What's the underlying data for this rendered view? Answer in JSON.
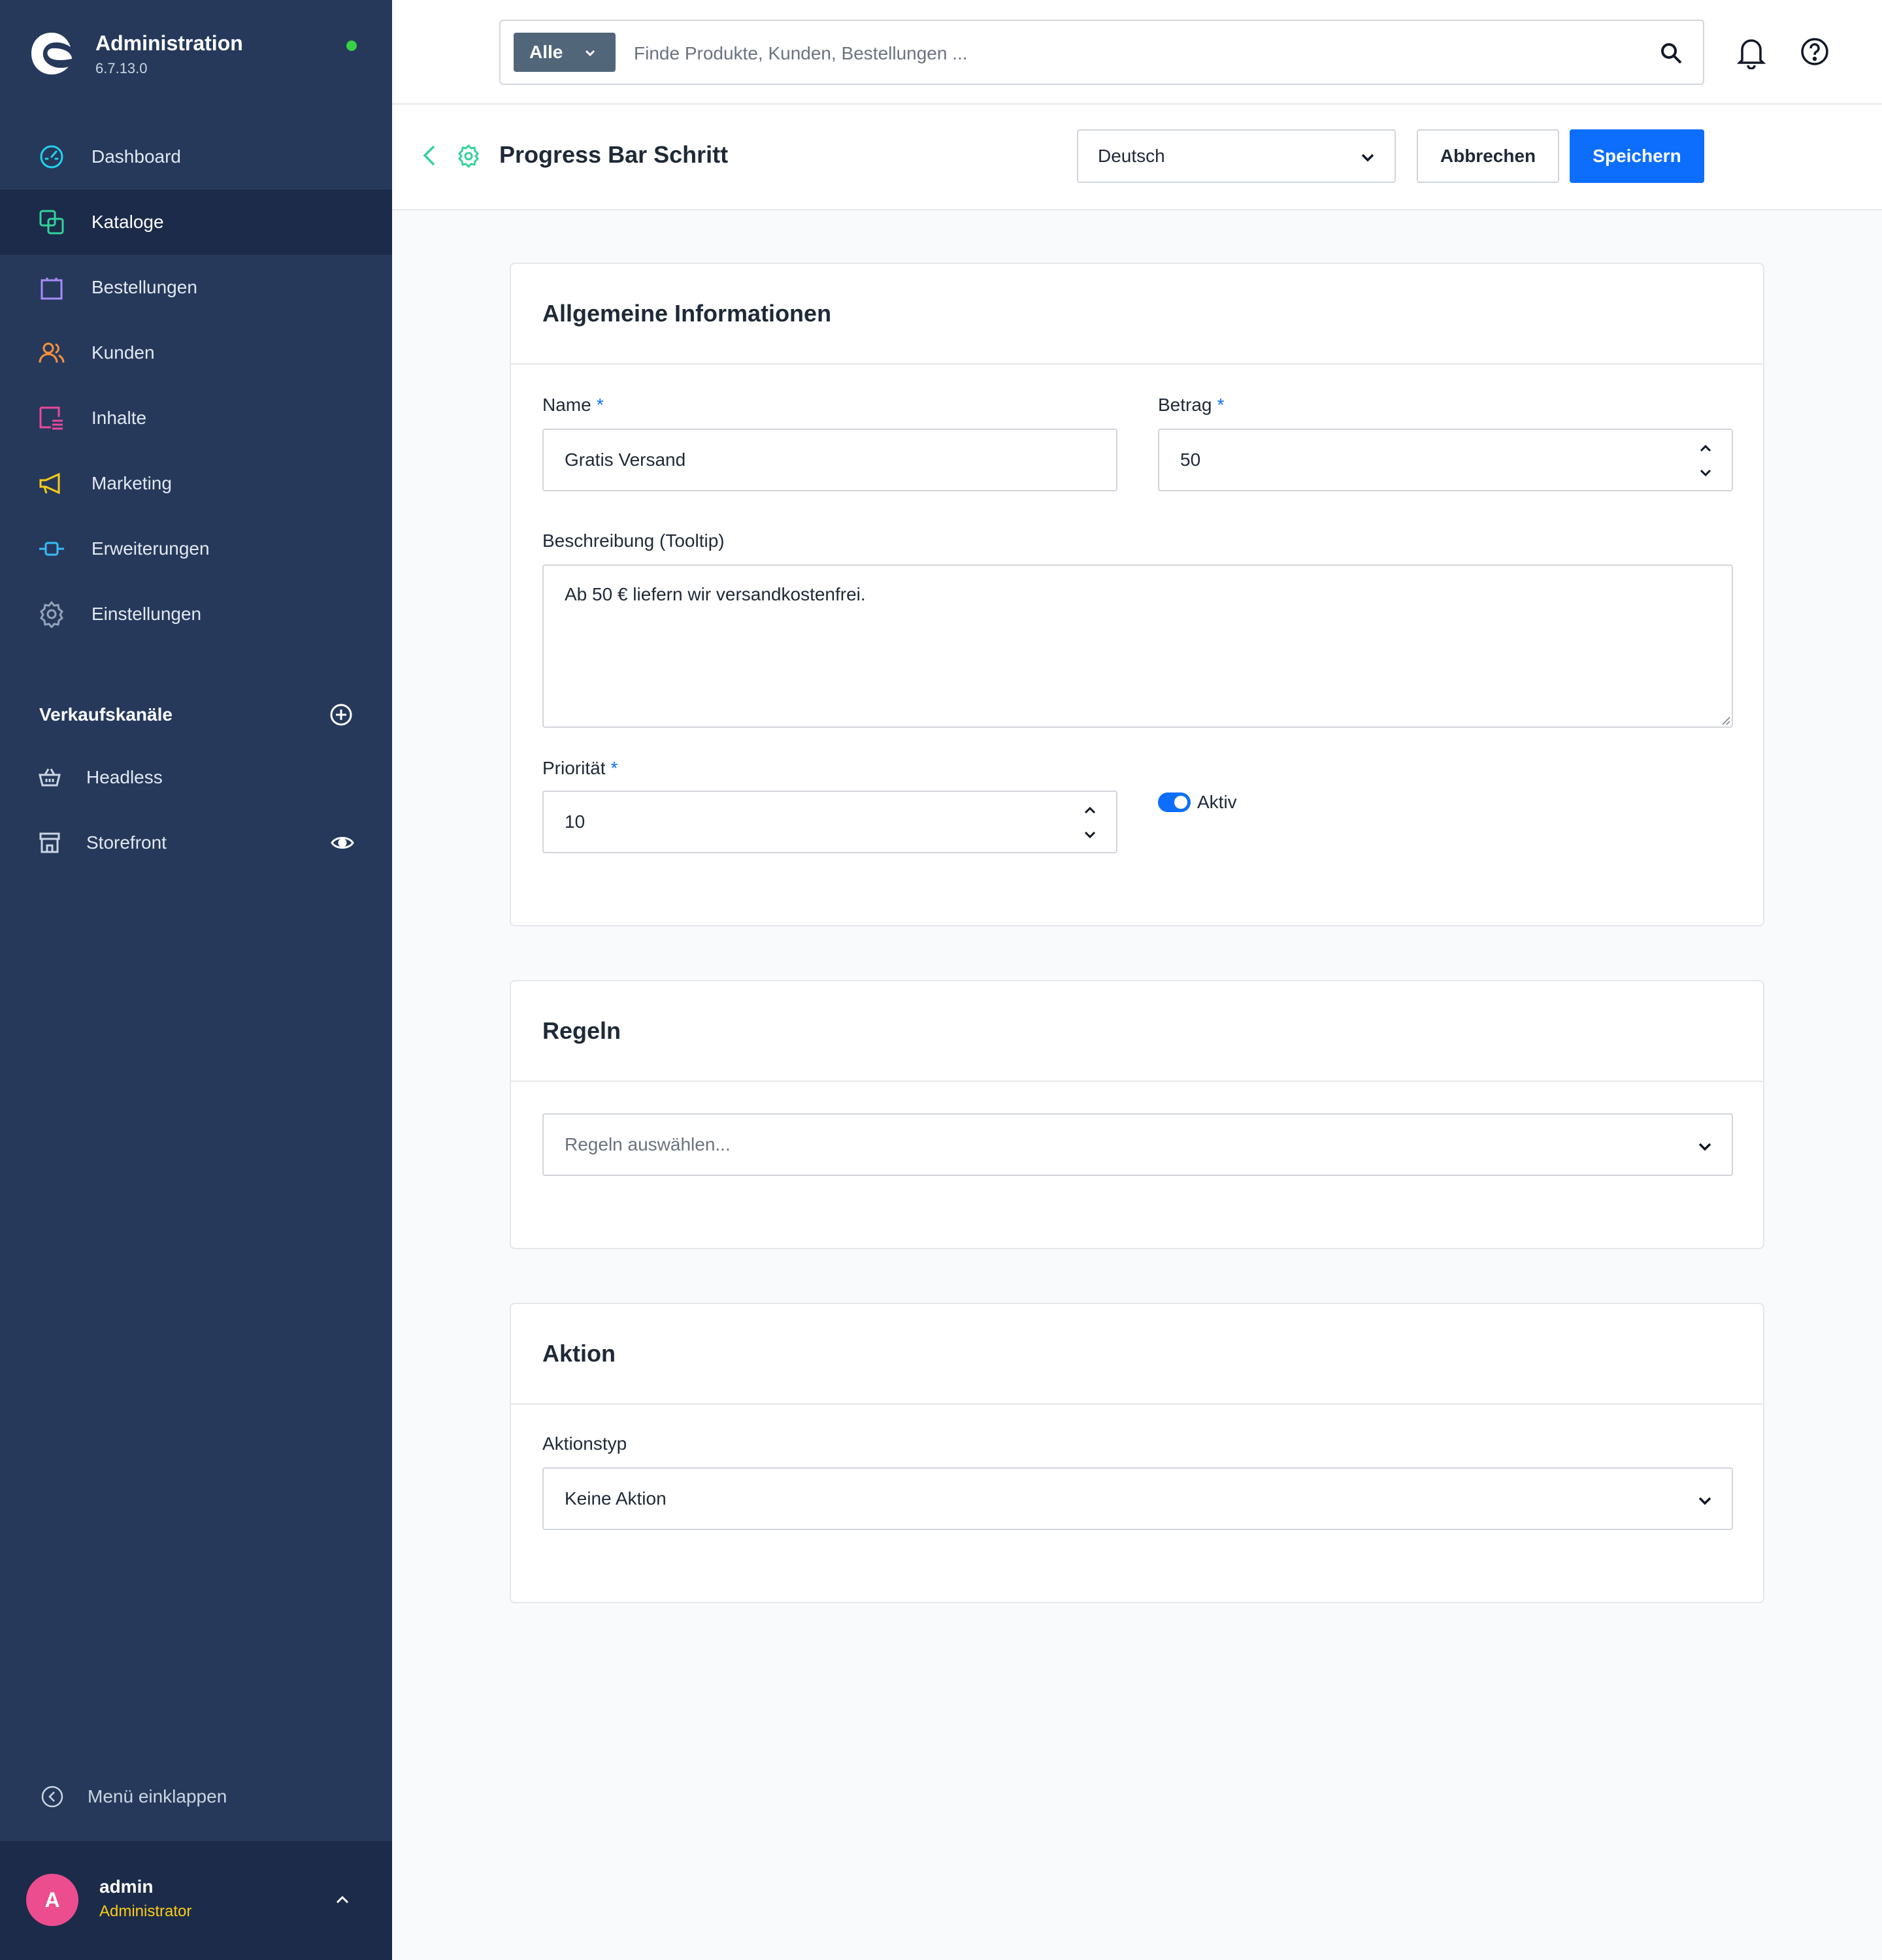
{
  "brand": {
    "title": "Administration",
    "version": "6.7.13.0"
  },
  "nav": [
    {
      "label": "Dashboard",
      "icon": "dashboard-icon",
      "color": "#22d3ee"
    },
    {
      "label": "Kataloge",
      "icon": "catalog-icon",
      "color": "#34d399",
      "active": true
    },
    {
      "label": "Bestellungen",
      "icon": "orders-icon",
      "color": "#a78bfa"
    },
    {
      "label": "Kunden",
      "icon": "customers-icon",
      "color": "#fb923c"
    },
    {
      "label": "Inhalte",
      "icon": "content-icon",
      "color": "#ec4899"
    },
    {
      "label": "Marketing",
      "icon": "marketing-icon",
      "color": "#facc15"
    },
    {
      "label": "Erweiterungen",
      "icon": "extensions-icon",
      "color": "#38bdf8"
    },
    {
      "label": "Einstellungen",
      "icon": "settings-icon",
      "color": "#94a3b8"
    }
  ],
  "sales_channels": {
    "title": "Verkaufskanäle",
    "items": [
      {
        "label": "Headless",
        "icon": "basket-icon"
      },
      {
        "label": "Storefront",
        "icon": "storefront-icon"
      }
    ]
  },
  "collapse_label": "Menü einklappen",
  "user": {
    "initial": "A",
    "name": "admin",
    "role": "Administrator"
  },
  "search": {
    "filter_label": "Alle",
    "placeholder": "Finde Produkte, Kunden, Bestellungen ..."
  },
  "smartbar": {
    "title": "Progress Bar Schritt",
    "language": "Deutsch",
    "cancel_label": "Abbrechen",
    "save_label": "Speichern"
  },
  "general": {
    "title": "Allgemeine Informationen",
    "name_label": "Name",
    "name_value": "Gratis Versand",
    "amount_label": "Betrag",
    "amount_value": "50",
    "description_label": "Beschreibung (Tooltip)",
    "description_value": "Ab 50 € liefern wir versandkostenfrei.",
    "priority_label": "Priorität",
    "priority_value": "10",
    "active_label": "Aktiv",
    "active": true,
    "required_mark": "*"
  },
  "rules": {
    "title": "Regeln",
    "placeholder": "Regeln auswählen..."
  },
  "action": {
    "title": "Aktion",
    "type_label": "Aktionstyp",
    "type_value": "Keine Aktion"
  },
  "colors": {
    "sidebar": "#26395b",
    "sidebar_active": "#1c2b4a",
    "primary": "#0d6efd",
    "status": "#37d046",
    "avatar": "#ec4d8e",
    "role": "#facc15"
  }
}
